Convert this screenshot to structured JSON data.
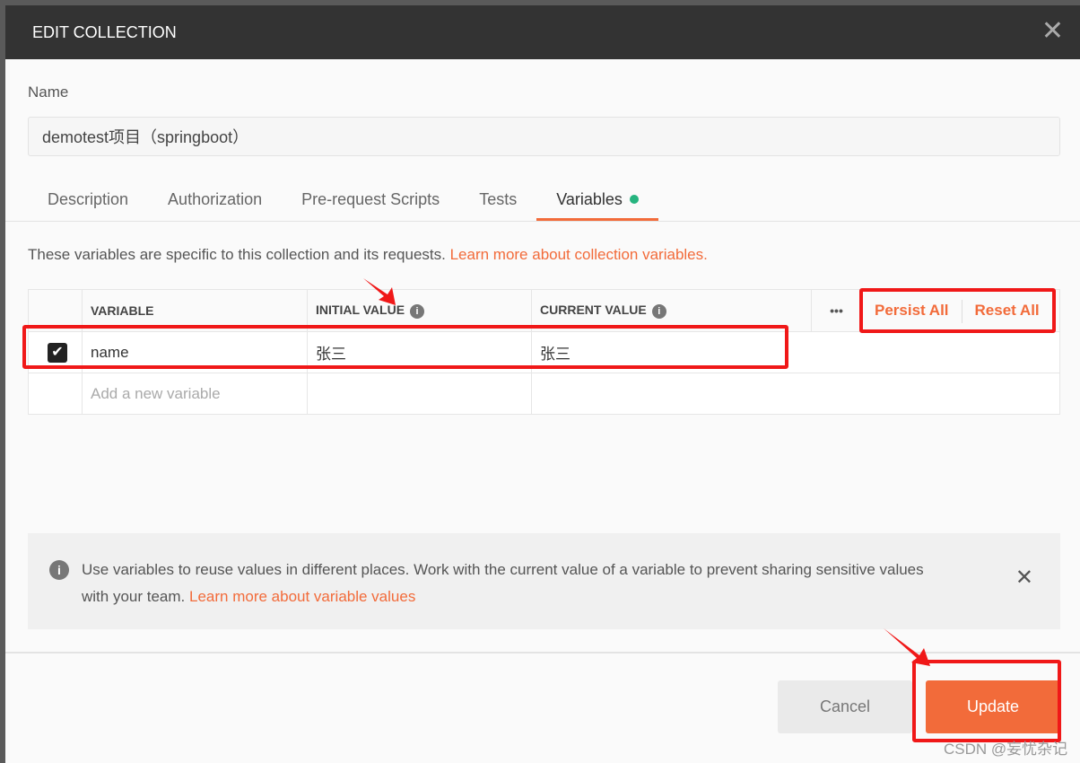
{
  "dialog": {
    "title": "EDIT COLLECTION",
    "close_icon": "close-icon"
  },
  "name": {
    "label": "Name",
    "value": "demotest项目（springboot）"
  },
  "tabs": [
    {
      "label": "Description"
    },
    {
      "label": "Authorization"
    },
    {
      "label": "Pre-request Scripts"
    },
    {
      "label": "Tests"
    },
    {
      "label": "Variables",
      "active": true
    }
  ],
  "variables": {
    "description": "These variables are specific to this collection and its requests.",
    "learn_link": "Learn more about collection variables.",
    "headers": {
      "variable": "VARIABLE",
      "initial": "INITIAL VALUE",
      "current": "CURRENT VALUE",
      "more": "•••",
      "persist": "Persist All",
      "reset": "Reset All"
    },
    "rows": [
      {
        "checked": true,
        "variable": "name",
        "initial": "张三",
        "current": "张三"
      }
    ],
    "add_placeholder": "Add a new variable"
  },
  "info": {
    "text": "Use variables to reuse values in different places. Work with the current value of a variable to prevent sharing sensitive values with your team.",
    "link": "Learn more about variable values"
  },
  "footer": {
    "cancel": "Cancel",
    "update": "Update"
  },
  "watermark": "CSDN @妄忧杂记",
  "colors": {
    "accent": "#f26b3a",
    "header": "#333333",
    "active_dot": "#26b47f",
    "annotation": "#f01818"
  }
}
